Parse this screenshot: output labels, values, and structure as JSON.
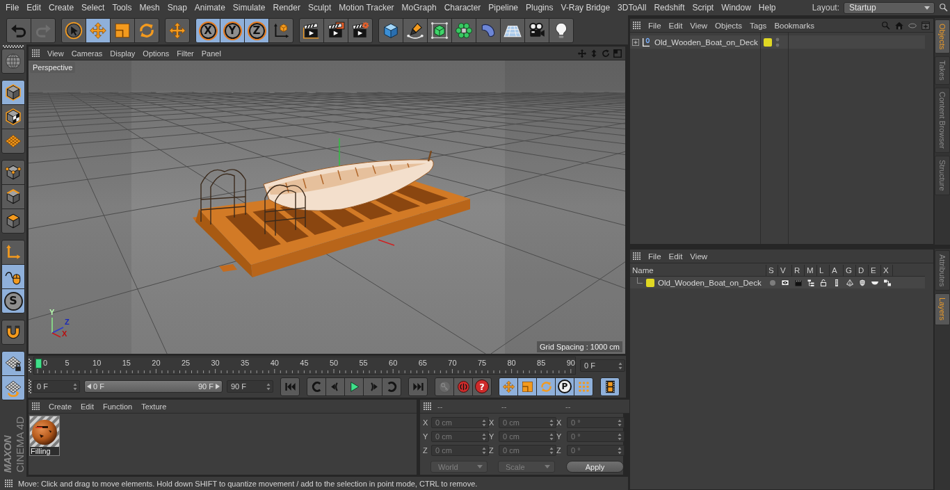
{
  "menubar": {
    "items": [
      "File",
      "Edit",
      "Create",
      "Select",
      "Tools",
      "Mesh",
      "Snap",
      "Animate",
      "Simulate",
      "Render",
      "Sculpt",
      "Motion Tracker",
      "MoGraph",
      "Character",
      "Pipeline",
      "Plugins",
      "V-Ray Bridge",
      "3DToAll",
      "Redshift",
      "Script",
      "Window",
      "Help"
    ],
    "layout_label": "Layout:",
    "layout_value": "Startup"
  },
  "toolbar": {
    "groups": [
      [
        {
          "kind": "undo",
          "selected": false,
          "disabled": false
        },
        {
          "kind": "redo",
          "selected": false,
          "disabled": true
        }
      ],
      [
        {
          "kind": "live-select",
          "selected": false,
          "disabled": false
        },
        {
          "kind": "move",
          "selected": true,
          "disabled": false
        },
        {
          "kind": "scale",
          "selected": false,
          "disabled": false
        },
        {
          "kind": "rotate",
          "selected": false,
          "disabled": false
        }
      ],
      [
        {
          "kind": "move",
          "selected": false,
          "disabled": false
        }
      ],
      [
        {
          "kind": "axis-lock",
          "label": "X",
          "selected": true,
          "disabled": false
        },
        {
          "kind": "axis-lock",
          "label": "Y",
          "selected": true,
          "disabled": false
        },
        {
          "kind": "axis-lock",
          "label": "Z",
          "selected": true,
          "disabled": false
        },
        {
          "kind": "coordinate-system",
          "selected": false,
          "disabled": false
        }
      ],
      [
        {
          "kind": "render-view",
          "selected": false,
          "disabled": false
        },
        {
          "kind": "render-picture",
          "selected": false,
          "disabled": false
        },
        {
          "kind": "render-settings",
          "selected": false,
          "disabled": false
        }
      ],
      [
        {
          "kind": "cube",
          "selected": false,
          "disabled": false
        },
        {
          "kind": "pen",
          "selected": false,
          "disabled": false
        },
        {
          "kind": "subdivision",
          "selected": false,
          "disabled": false
        },
        {
          "kind": "cloner",
          "selected": false,
          "disabled": false
        },
        {
          "kind": "bend",
          "selected": false,
          "disabled": false
        },
        {
          "kind": "floor",
          "selected": false,
          "disabled": false
        },
        {
          "kind": "camera",
          "selected": false,
          "disabled": false
        },
        {
          "kind": "light",
          "selected": false,
          "disabled": false
        }
      ]
    ]
  },
  "left_tools": {
    "groups": [
      [
        {
          "kind": "globe",
          "selected": false
        }
      ],
      [
        {
          "kind": "model",
          "selected": true
        },
        {
          "kind": "texture",
          "selected": false
        },
        {
          "kind": "workplane",
          "selected": false
        }
      ],
      [
        {
          "kind": "points",
          "selected": false
        },
        {
          "kind": "edges",
          "selected": false
        },
        {
          "kind": "polygons",
          "selected": false
        }
      ],
      [
        {
          "kind": "axis",
          "selected": false
        },
        {
          "kind": "tweak",
          "selected": true
        },
        {
          "kind": "snap",
          "label": "S",
          "selected": true
        }
      ],
      [
        {
          "kind": "magnet",
          "selected": false
        }
      ],
      [
        {
          "kind": "workplane-lock",
          "selected": true
        },
        {
          "kind": "planar",
          "selected": true
        }
      ]
    ],
    "logo": {
      "brand": "MAXON",
      "product": "CINEMA 4D"
    }
  },
  "viewport": {
    "menu": [
      "View",
      "Cameras",
      "Display",
      "Options",
      "Filter",
      "Panel"
    ],
    "camera": "Perspective",
    "axis_labels": [
      "Y",
      "Z",
      "X"
    ],
    "grid_spacing": "Grid Spacing : 1000 cm"
  },
  "timeline": {
    "frames": [
      "0",
      "5",
      "10",
      "15",
      "20",
      "25",
      "30",
      "35",
      "40",
      "45",
      "50",
      "55",
      "60",
      "65",
      "70",
      "75",
      "80",
      "85",
      "90"
    ],
    "playhead": {
      "level": 0
    },
    "current_frame": "0 F",
    "start_field": "0 F",
    "range_slider": {
      "start": {
        "label": "0 F",
        "level": 0
      },
      "end": {
        "label": "90 F",
        "level": 1
      }
    },
    "end_field": "90 F",
    "transport": [
      [
        {
          "kind": "go-start",
          "selected": false,
          "disabled": false
        }
      ],
      [
        {
          "kind": "prev-key",
          "selected": false,
          "disabled": false
        },
        {
          "kind": "prev-frame",
          "selected": false,
          "disabled": false
        },
        {
          "kind": "play",
          "selected": false,
          "disabled": false
        },
        {
          "kind": "next-frame",
          "selected": false,
          "disabled": false
        },
        {
          "kind": "next-key",
          "selected": false,
          "disabled": false
        }
      ],
      [
        {
          "kind": "go-end",
          "selected": false,
          "disabled": false
        }
      ],
      [
        {
          "kind": "record-keys",
          "selected": false,
          "disabled": true
        },
        {
          "kind": "record",
          "selected": false,
          "disabled": false
        },
        {
          "kind": "autokey",
          "label": "?",
          "selected": false,
          "disabled": false
        }
      ],
      [
        {
          "kind": "key-position",
          "selected": true,
          "disabled": false
        },
        {
          "kind": "key-scale",
          "selected": true,
          "disabled": false
        },
        {
          "kind": "key-rotation",
          "selected": true,
          "disabled": false
        },
        {
          "kind": "key-parameter",
          "label": "P",
          "selected": true,
          "disabled": false
        },
        {
          "kind": "key-points",
          "selected": true,
          "disabled": false
        }
      ],
      [
        {
          "kind": "timeline-window",
          "selected": true,
          "disabled": false
        }
      ]
    ]
  },
  "materials": {
    "menu": [
      "Create",
      "Edit",
      "Function",
      "Texture"
    ],
    "items": [
      {
        "name": "Filling"
      }
    ]
  },
  "coordinates": {
    "headers": [
      "--",
      "--",
      "--"
    ],
    "rows": [
      {
        "labels": [
          "X",
          "X",
          "X"
        ],
        "values": [
          "0 cm",
          "0 cm",
          "0 °"
        ]
      },
      {
        "labels": [
          "Y",
          "Y",
          "Y"
        ],
        "values": [
          "0 cm",
          "0 cm",
          "0 °"
        ]
      },
      {
        "labels": [
          "Z",
          "Z",
          "Z"
        ],
        "values": [
          "0 cm",
          "0 cm",
          "0 °"
        ]
      }
    ],
    "disabled": true,
    "menus": [
      "World",
      "Scale"
    ],
    "apply": "Apply"
  },
  "status_bar": "Move: Click and drag to move elements. Hold down SHIFT to quantize movement / add to the selection in point mode, CTRL to remove.",
  "objects_panel": {
    "menu": [
      "File",
      "Edit",
      "View",
      "Objects",
      "Tags",
      "Bookmarks"
    ],
    "objects": [
      {
        "name": "Old_Wooden_Boat_on_Deck",
        "expanded": false,
        "color": "#e0d823"
      }
    ],
    "side_tabs": [
      {
        "label": "Objects",
        "selected": true
      },
      {
        "label": "Takes",
        "selected": false
      },
      {
        "label": "Content Browser",
        "selected": false
      },
      {
        "label": "Structure",
        "selected": false
      }
    ]
  },
  "layers_panel": {
    "menu": [
      "File",
      "Edit",
      "View"
    ],
    "columns": [
      "Name",
      "S",
      "V",
      "R",
      "M",
      "L",
      "A",
      "G",
      "D",
      "E",
      "X"
    ],
    "layers": [
      {
        "name": "Old_Wooden_Boat_on_Deck",
        "color": "#e0d823"
      }
    ],
    "side_tabs": [
      {
        "label": "Attributes",
        "selected": false
      },
      {
        "label": "Layers",
        "selected": true
      }
    ]
  }
}
